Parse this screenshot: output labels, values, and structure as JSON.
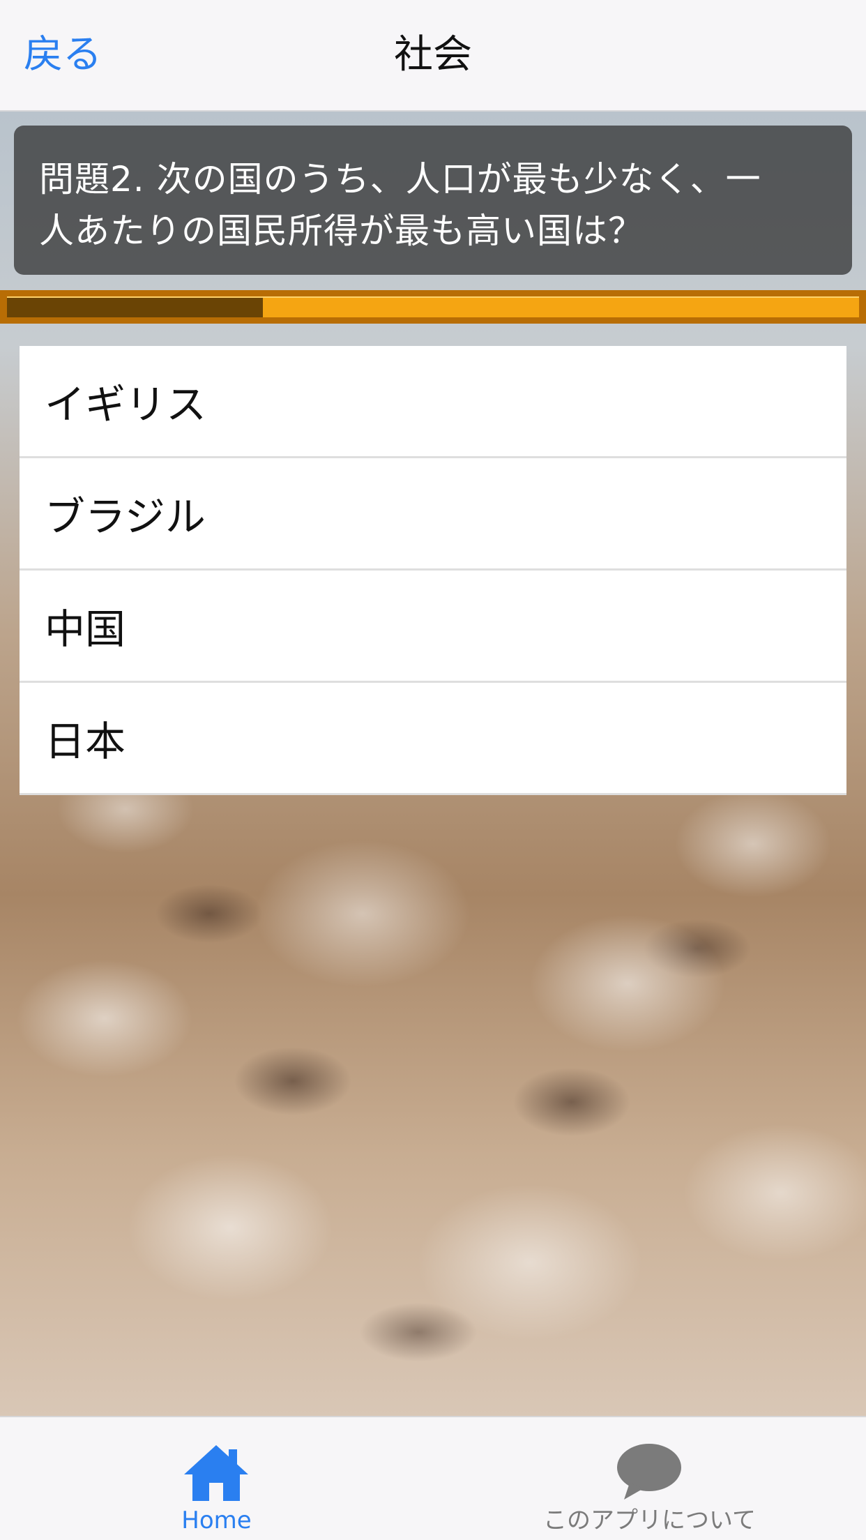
{
  "nav": {
    "back_label": "戻る",
    "title": "社会"
  },
  "question": {
    "text_line1": "問題2. 次の国のうち、人口が最も少なく、一",
    "text_line2": "人あたりの国民所得が最も高い国は？"
  },
  "progress": {
    "fraction": 0.3
  },
  "answers": [
    {
      "label": "イギリス"
    },
    {
      "label": "ブラジル"
    },
    {
      "label": "中国"
    },
    {
      "label": "日本"
    }
  ],
  "tabbar": {
    "home_label": "Home",
    "home_icon": "home-icon",
    "about_label": "このアプリについて",
    "about_icon": "speech-bubble-icon"
  },
  "colors": {
    "accent": "#2a7ff0",
    "progress_track": "#f5a512",
    "progress_fill": "#6a4405",
    "progress_frame": "#b86d05"
  }
}
